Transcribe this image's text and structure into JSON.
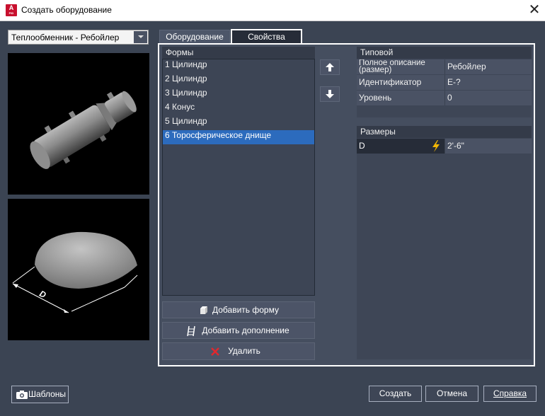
{
  "window": {
    "title": "Создать оборудование",
    "app_icon_letter": "A",
    "app_icon_sub": "PID"
  },
  "equipment_type": {
    "selected": "Теплообменник - Ребойлер"
  },
  "tabs": [
    {
      "label": "Оборудование"
    },
    {
      "label": "Свойства"
    }
  ],
  "shapes": {
    "header": "Формы",
    "items": [
      {
        "label": "1 Цилиндр"
      },
      {
        "label": "2 Цилиндр"
      },
      {
        "label": "3 Цилиндр"
      },
      {
        "label": "4 Конус"
      },
      {
        "label": "5 Цилиндр"
      },
      {
        "label": "6 Торосферическое днище"
      }
    ],
    "selected_index": 5
  },
  "buttons": {
    "add_shape": "Добавить форму",
    "add_addition": "Добавить дополнение",
    "delete": "Удалить",
    "templates": "Шаблоны",
    "create": "Создать",
    "cancel": "Отмена",
    "help": "Справка"
  },
  "typical": {
    "header": "Типовой",
    "rows": [
      {
        "label": "Полное описание (размер)",
        "value": "Ребойлер"
      },
      {
        "label": "Идентификатор",
        "value": "E-?"
      },
      {
        "label": "Уровень",
        "value": "0"
      }
    ]
  },
  "dimensions": {
    "header": "Размеры",
    "rows": [
      {
        "label": "D",
        "value": "2'-6\""
      }
    ]
  },
  "preview": {
    "dimension_label": "D"
  },
  "colors": {
    "background": "#3b4453",
    "selection": "#2c6bbd",
    "delete_icon": "#e0282e",
    "lightning": "#f2b705"
  }
}
